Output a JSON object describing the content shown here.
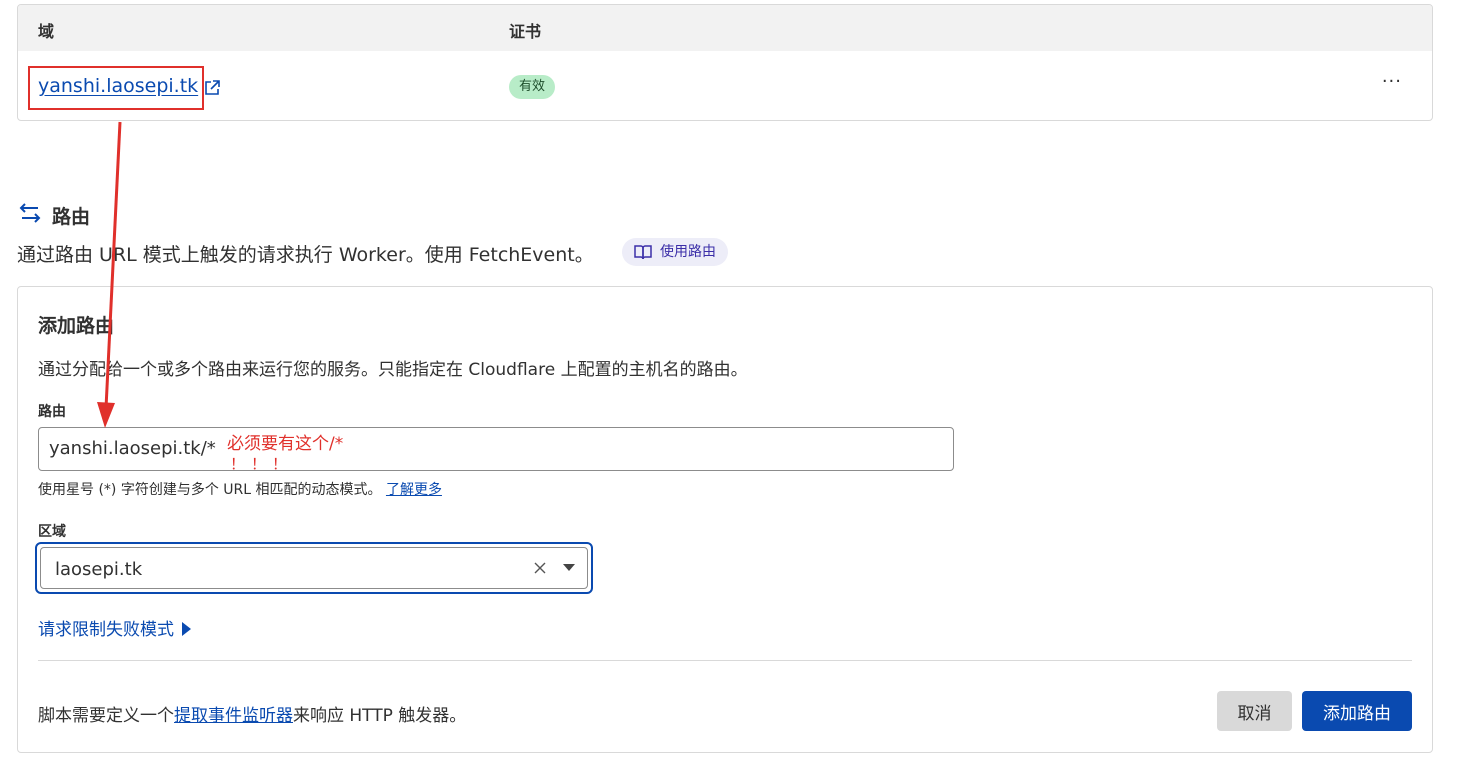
{
  "domains_table": {
    "columns": [
      "域",
      "证书"
    ],
    "rows": [
      {
        "domain": "yanshi.laosepi.tk",
        "certificate": "有效"
      }
    ],
    "more_label": "···"
  },
  "routes": {
    "title": "路由",
    "description": "通过路由 URL 模式上触发的请求执行 Worker。使用 FetchEvent。",
    "docs_label": "使用路由"
  },
  "add_route": {
    "title": "添加路由",
    "description": "通过分配给一个或多个路由来运行您的服务。只能指定在 Cloudflare 上配置的主机名的路由。",
    "route_label": "路由",
    "route_value": "yanshi.laosepi.tk/*",
    "route_help": "使用星号 (*) 字符创建与多个 URL 相匹配的动态模式。",
    "learn_more": "了解更多",
    "zone_label": "区域",
    "zone_value": "laosepi.tk",
    "fail_mode": "请求限制失败模式",
    "footer_prefix": "脚本需要定义一个",
    "footer_link": "提取事件监听器",
    "footer_suffix": "来响应 HTTP 触发器。",
    "cancel_label": "取消",
    "submit_label": "添加路由"
  },
  "annotation": {
    "note_line1": "必须要有这个/*",
    "note_line2": "！！！"
  },
  "colors": {
    "link": "#0a4ab0",
    "annotation": "#e0302b",
    "badge_bg": "#b8ecc8"
  }
}
